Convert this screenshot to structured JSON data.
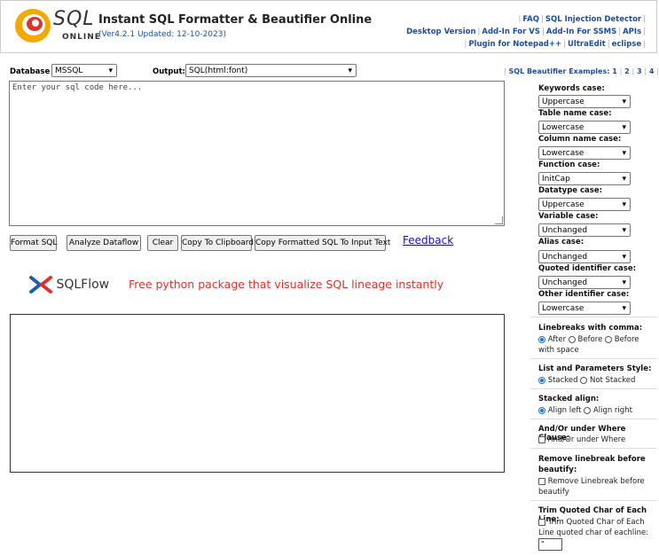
{
  "header": {
    "logo_sql": "SQL",
    "logo_online": "ONLINE",
    "title": "Instant SQL Formatter & Beautifier Online",
    "version": "(Ver4.2.1 Updated: 12-10-2023)",
    "links_row1": [
      "FAQ",
      "SQL Injection Detector"
    ],
    "links_row2": [
      "Desktop Version",
      "Add-In For VS",
      "Add-In For SSMS",
      "APIs"
    ],
    "links_row3": [
      "Plugin for Notepad++",
      "UltraEdit",
      "eclipse"
    ]
  },
  "toolbar": {
    "database_label": "Database",
    "database_value": "MSSQL",
    "output_label": "Output:",
    "output_value": "SQL(html:font)",
    "examples_label": "SQL Beautifier Examples:",
    "examples": [
      "1",
      "2",
      "3",
      "4"
    ]
  },
  "input": {
    "placeholder": "Enter your sql code here..."
  },
  "buttons": {
    "format": "Format SQL",
    "analyze": "Analyze Dataflow",
    "clear": "Clear",
    "copy": "Copy To Clipboard",
    "copy_formatted": "Copy Formatted SQL To Input Text",
    "feedback": "Feedback"
  },
  "promo": {
    "logo_text": "SQLFlow",
    "text": "Free python package that visualize SQL lineage instantly"
  },
  "options": {
    "keywords": {
      "label": "Keywords case:",
      "value": "Uppercase"
    },
    "table": {
      "label": "Table name case:",
      "value": "Lowercase"
    },
    "column": {
      "label": "Column name case:",
      "value": "Lowercase"
    },
    "function": {
      "label": "Function case:",
      "value": "InitCap"
    },
    "datatype": {
      "label": "Datatype case:",
      "value": "Uppercase"
    },
    "variable": {
      "label": "Variable case:",
      "value": "Unchanged"
    },
    "alias": {
      "label": "Alias case:",
      "value": "Unchanged"
    },
    "quoted": {
      "label": "Quoted identifier case:",
      "value": "Unchanged"
    },
    "other": {
      "label": "Other identifier case:",
      "value": "Lowercase"
    },
    "linebreaks": {
      "label": "Linebreaks with comma:",
      "opt1": "After",
      "opt2": "Before",
      "opt3": "Before with space"
    },
    "list_style": {
      "label": "List and Parameters Style:",
      "opt1": "Stacked",
      "opt2": "Not Stacked"
    },
    "stacked_align": {
      "label": "Stacked align:",
      "opt1": "Align left",
      "opt2": "Align right"
    },
    "andor": {
      "label": "And/Or under Where Clause:",
      "opt1": "And/Or under Where"
    },
    "remove_lb": {
      "label": "Remove linebreak before beautify:",
      "opt1": "Remove Linebreak before beautify"
    },
    "trim": {
      "label": "Trim Quoted Char of Each Line:",
      "opt1": "Trim Quoted Char of Each Line quoted char of eachline:",
      "value": "\""
    }
  }
}
